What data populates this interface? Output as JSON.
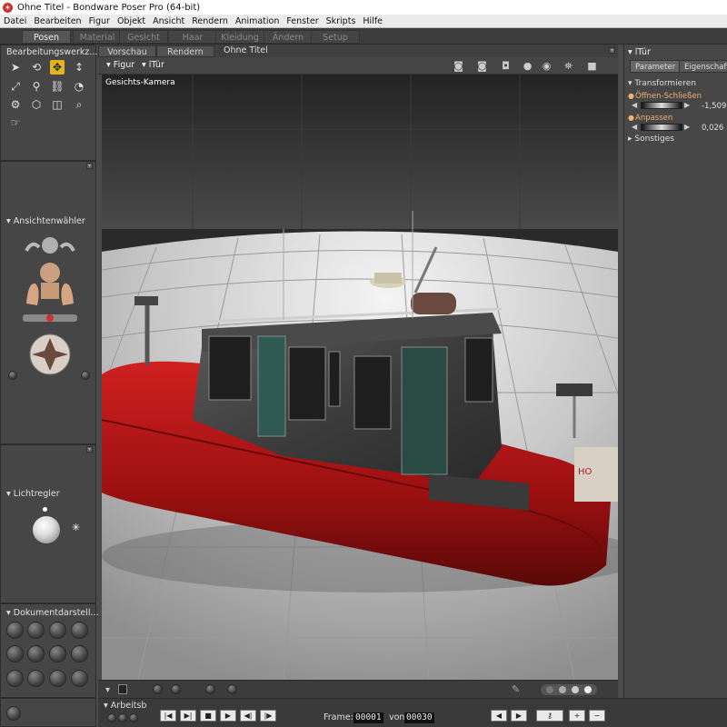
{
  "window": {
    "title": "Ohne Titel - Bondware Poser Pro  (64-bit)"
  },
  "menu": [
    "Datei",
    "Bearbeiten",
    "Figur",
    "Objekt",
    "Ansicht",
    "Rendern",
    "Animation",
    "Fenster",
    "Skripts",
    "Hilfe"
  ],
  "rooms": [
    "Posen",
    "Material",
    "Gesicht",
    "Haar",
    "Kleidung",
    "Ändern",
    "Setup"
  ],
  "active_room": "Posen",
  "left_panels": {
    "tools_title": "Bearbeitungswerkz...",
    "camera_title": "Ansichtenwähler",
    "light_title": "Lichtregler",
    "doc_title": "Dokumentdarstell..."
  },
  "view_tabs": [
    "Vorschau",
    "Rendern"
  ],
  "document_title": "Ohne Titel",
  "viewport_toolbar": {
    "figure_menu": "Figur",
    "actor_menu": "lTür"
  },
  "camera_label": "Gesichts-Kamera",
  "right_panel": {
    "actor": "lTür",
    "tabs": [
      "Parameter",
      "Eigenschaften"
    ],
    "groups": {
      "transform": "Transformieren",
      "other": "Sonstiges"
    },
    "params": [
      {
        "name": "Öffnen-Schließen",
        "value": "-1,509"
      },
      {
        "name": "Anpassen",
        "value": "0,026"
      }
    ]
  },
  "animation": {
    "library_label": "Arbeitsb",
    "frame_label": "Frame:",
    "frame_current": "00001",
    "of_label": "von",
    "frame_total": "00030"
  }
}
